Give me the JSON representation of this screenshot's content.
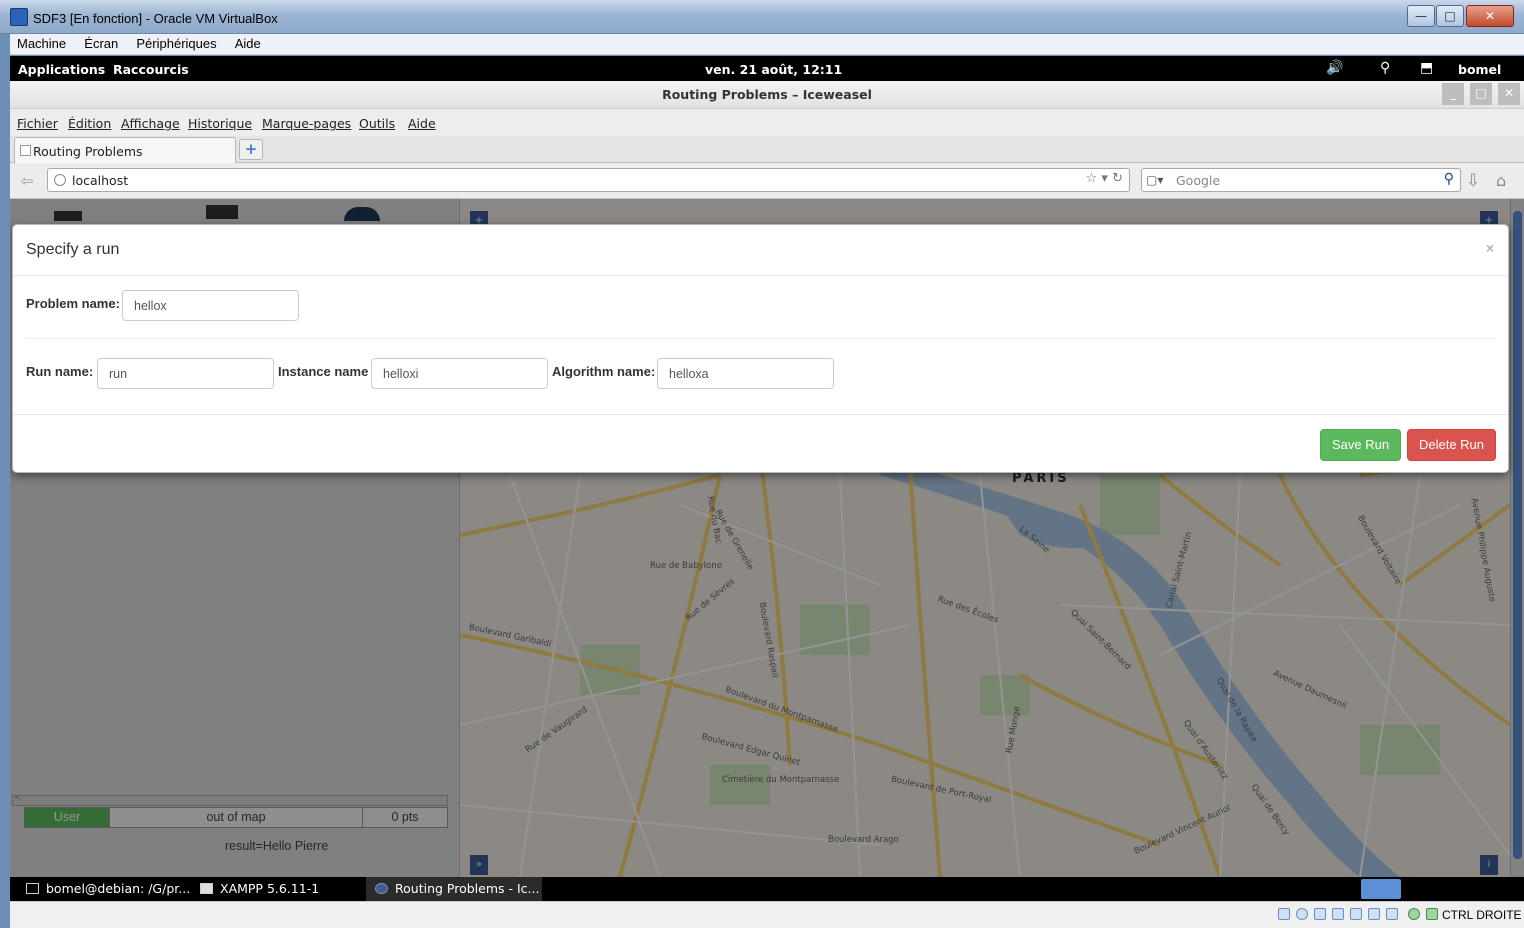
{
  "host_window": {
    "title": "SDF3 [En fonction] - Oracle VM VirtualBox",
    "menu": [
      "Machine",
      "Écran",
      "Périphériques",
      "Aide"
    ]
  },
  "gnome_panel": {
    "applications": "Applications",
    "shortcuts": "Raccourcis",
    "clock": "ven. 21 août, 12:11",
    "user": "bomel"
  },
  "browser": {
    "window_title": "Routing Problems – Iceweasel",
    "menu": [
      "Fichier",
      "Édition",
      "Affichage",
      "Historique",
      "Marque-pages",
      "Outils",
      "Aide"
    ],
    "tab_label": "Routing Problems",
    "url": "localhost",
    "search_placeholder": "Google"
  },
  "modal": {
    "title": "Specify a run",
    "close": "×",
    "problem_label": "Problem name:",
    "problem_value": "hellox",
    "run_label": "Run name:",
    "run_value": "run",
    "instance_label": "Instance name",
    "instance_value": "helloxi",
    "algorithm_label": "Algorithm name:",
    "algorithm_value": "helloxa",
    "save_label": "Save Run",
    "delete_label": "Delete Run",
    "colors": {
      "save": "#5cb85c",
      "delete": "#d9534f"
    }
  },
  "sidebar": {
    "status_user": "User",
    "status_location": "out of map",
    "status_points": "0 pts",
    "result": "result=Hello Pierre"
  },
  "map": {
    "city": "PARIS",
    "streets": [
      "Rue de Babylone",
      "Boulevard Garibaldi",
      "Boulevard du Montparnasse",
      "Boulevard Raspail",
      "Rue de Vaugirard",
      "Boulevard de Port-Royal",
      "Quai Saint-Bernard",
      "Quai d'Austerlitz",
      "Quai de la Rapée",
      "Quai de Bercy",
      "Boulevard Arago",
      "Avenue Daumesnil",
      "Rue des Écoles",
      "Rue Monge",
      "Boulevard Vincent Auriol",
      "Rue de Sèvres",
      "Rue de Grenelle",
      "Rue du Bac",
      "Boulevard Edgar Quinet",
      "Cimetière du Montparnasse",
      "La Seine",
      "Canal Saint-Martin",
      "Boulevard Voltaire",
      "Avenue Philippe Auguste"
    ]
  },
  "taskbar": {
    "items": [
      "bomel@debian: /G/pr...",
      "XAMPP 5.6.11-1",
      "Routing Problems - Ic..."
    ]
  },
  "vbox_status": {
    "host_key": "CTRL DROITE"
  }
}
